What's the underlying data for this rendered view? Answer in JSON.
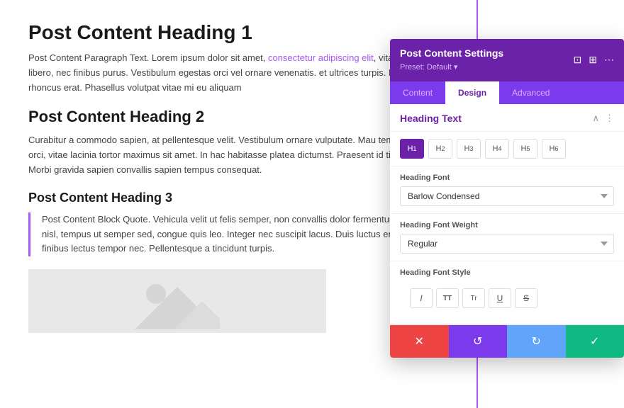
{
  "content": {
    "heading1": "Post Content Heading 1",
    "paragraph1_start": "Post Content Paragraph Text. Lorem ipsum dolor sit amet, ",
    "paragraph1_link": "consectetur adipiscing elit",
    "paragraph1_end": ", vitae congue libero, nec finibus purus. Vestibulum egestas orci vel ornare venenatis. et ultrices turpis. Donec sit amet rhoncus erat. Phasellus volutpat vitae mi eu aliquam",
    "heading2": "Post Content Heading 2",
    "paragraph2": "Curabitur a commodo sapien, at pellentesque velit. Vestibulum ornare vulputate. Mau tempus massa orci, vitae lacinia tortor maximus sit amet. In hac habitasse platea dictumst. Praesent id tincidunt dolor. Morbi gravida sapien convallis sapien tempus consequat.",
    "heading3": "Post Content Heading 3",
    "blockquote": "Post Content Block Quote. Vehicula velit ut felis semper, non convallis dolor fermentum. Sed sapien nisl, tempus ut semper sed, congue quis leo. Integer nec suscipit lacus. Duis luctus eros dui, nec finibus lectus tempor nec. Pellentesque a tincidunt turpis."
  },
  "panel": {
    "title": "Post Content Settings",
    "preset": "Preset: Default ▾",
    "tabs": [
      {
        "label": "Content",
        "active": false
      },
      {
        "label": "Design",
        "active": true
      },
      {
        "label": "Advanced",
        "active": false
      }
    ],
    "section_title": "Heading Text",
    "h_buttons": [
      "H₁",
      "H₂",
      "H₃",
      "H₄",
      "H₅",
      "H₆"
    ],
    "heading_font_label": "Heading Font",
    "heading_font_value": "Barlow Condensed",
    "heading_font_weight_label": "Heading Font Weight",
    "heading_font_weight_value": "Regular",
    "heading_font_style_label": "Heading Font Style",
    "style_buttons": [
      {
        "label": "I",
        "type": "italic"
      },
      {
        "label": "TT",
        "type": "allcaps"
      },
      {
        "label": "Tr",
        "type": "capitalize"
      },
      {
        "label": "U",
        "type": "underline"
      },
      {
        "label": "S̶",
        "type": "strikethrough"
      }
    ],
    "footer_buttons": [
      {
        "label": "✕",
        "type": "red"
      },
      {
        "label": "↺",
        "type": "purple"
      },
      {
        "label": "↻",
        "type": "blue"
      },
      {
        "label": "✓",
        "type": "green"
      }
    ]
  }
}
